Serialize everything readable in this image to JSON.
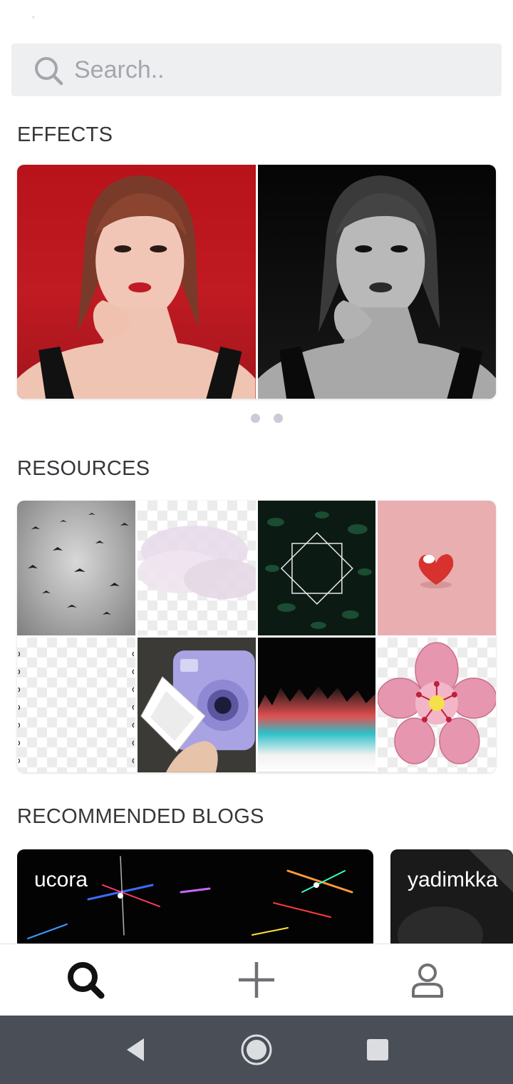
{
  "search": {
    "placeholder": "Search..",
    "icon": "search-icon"
  },
  "sections": {
    "effects_title": "EFFECTS",
    "resources_title": "RESOURCES",
    "blogs_title": "RECOMMENDED BLOGS"
  },
  "effects": {
    "items": [
      {
        "name": "effect-original",
        "description": "portrait on red background"
      },
      {
        "name": "effect-monochrome",
        "description": "portrait in black and white"
      }
    ],
    "page_indicator_count": 2
  },
  "resources": {
    "tiles": [
      "birds-sky",
      "clouds-transparent",
      "leaves-diamond-frame",
      "heart-sticker",
      "transparent-border",
      "instax-camera",
      "glitch-light",
      "pink-flower"
    ]
  },
  "blogs": [
    {
      "name": "ucora"
    },
    {
      "name": "yadimkka"
    }
  ],
  "bottom_nav": {
    "items": [
      "search-icon",
      "plus-icon",
      "profile-icon"
    ],
    "active": "search-icon"
  },
  "system_nav": {
    "items": [
      "back-icon",
      "home-icon",
      "recents-icon"
    ]
  },
  "colors": {
    "search_bg": "#eeeff1",
    "placeholder": "#a4a6ae",
    "section_title": "#36363b",
    "indicator": "#c9ccd8",
    "system_bar": "#4a4f57"
  }
}
